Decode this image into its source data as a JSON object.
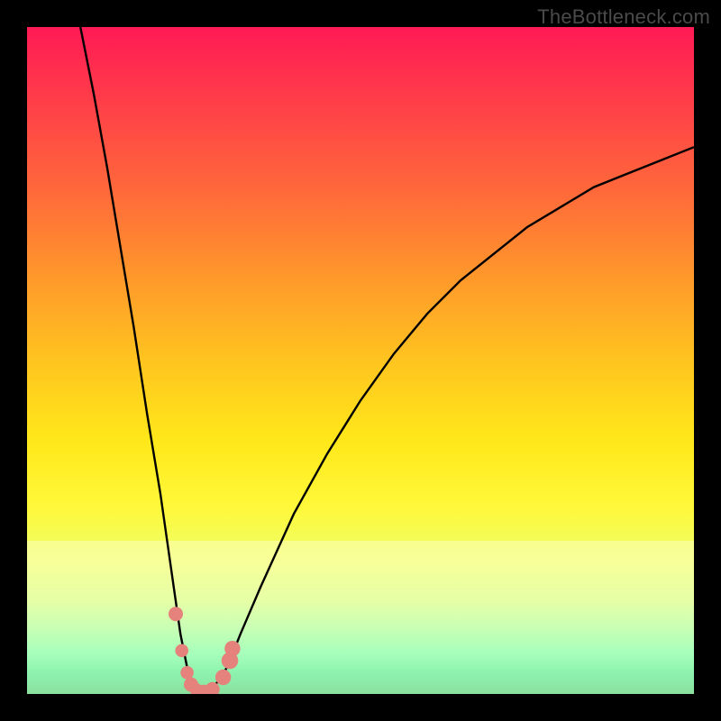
{
  "attribution": "TheBottleneck.com",
  "colors": {
    "frame": "#000000",
    "curve_stroke": "#000000",
    "dot_fill": "#e4827b",
    "gradient_top": "#ff1a55",
    "gradient_bottom": "#00b97a"
  },
  "chart_data": {
    "type": "line",
    "title": "",
    "xlabel": "",
    "ylabel": "",
    "xlim": [
      0,
      100
    ],
    "ylim": [
      0,
      100
    ],
    "series": [
      {
        "name": "bottleneck-curve",
        "x": [
          8,
          10,
          12,
          14,
          16,
          18,
          20,
          22,
          23,
          24,
          25,
          26,
          27,
          28,
          30,
          32,
          35,
          40,
          45,
          50,
          55,
          60,
          65,
          70,
          75,
          80,
          85,
          90,
          95,
          100
        ],
        "y": [
          100,
          90,
          79,
          67,
          55,
          42,
          30,
          16,
          9,
          4,
          1,
          0,
          0,
          1,
          4,
          9,
          16,
          27,
          36,
          44,
          51,
          57,
          62,
          66,
          70,
          73,
          76,
          78,
          80,
          82
        ]
      }
    ],
    "markers": [
      {
        "x": 22.3,
        "y": 12.0,
        "r": 1.2
      },
      {
        "x": 23.2,
        "y": 6.5,
        "r": 1.1
      },
      {
        "x": 24.0,
        "y": 3.2,
        "r": 1.1
      },
      {
        "x": 24.6,
        "y": 1.4,
        "r": 1.2
      },
      {
        "x": 25.4,
        "y": 0.6,
        "r": 1.1
      },
      {
        "x": 26.5,
        "y": 0.4,
        "r": 1.1
      },
      {
        "x": 27.8,
        "y": 0.7,
        "r": 1.2
      },
      {
        "x": 29.4,
        "y": 2.5,
        "r": 1.3
      },
      {
        "x": 30.4,
        "y": 5.0,
        "r": 1.4
      },
      {
        "x": 30.8,
        "y": 6.8,
        "r": 1.3
      }
    ],
    "baseline_band": {
      "y_from": 0,
      "y_to": 23
    }
  }
}
